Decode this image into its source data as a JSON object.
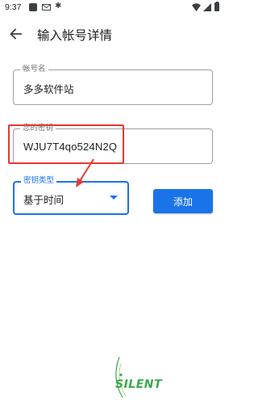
{
  "status_bar": {
    "time": "9:37",
    "icons": [
      "square-notification-icon",
      "mail-icon",
      "bug-icon",
      "wifi-icon",
      "cell-signal-icon",
      "battery-icon"
    ]
  },
  "app_bar": {
    "title": "输入帐号详情",
    "back_icon": "arrow-left-icon"
  },
  "form": {
    "account_name": {
      "label": "帐号名",
      "value": "多多软件站"
    },
    "secret_key": {
      "label": "您的密钥",
      "value": "WJU7T4qo524N2Q"
    },
    "key_type": {
      "label": "密钥类型",
      "value": "基于时间"
    },
    "add_label": "添加"
  },
  "colors": {
    "accent": "#1a73e8",
    "annotation": "#e53935",
    "watermark": "#3aa84a"
  },
  "watermark": {
    "text": "SILENT"
  }
}
